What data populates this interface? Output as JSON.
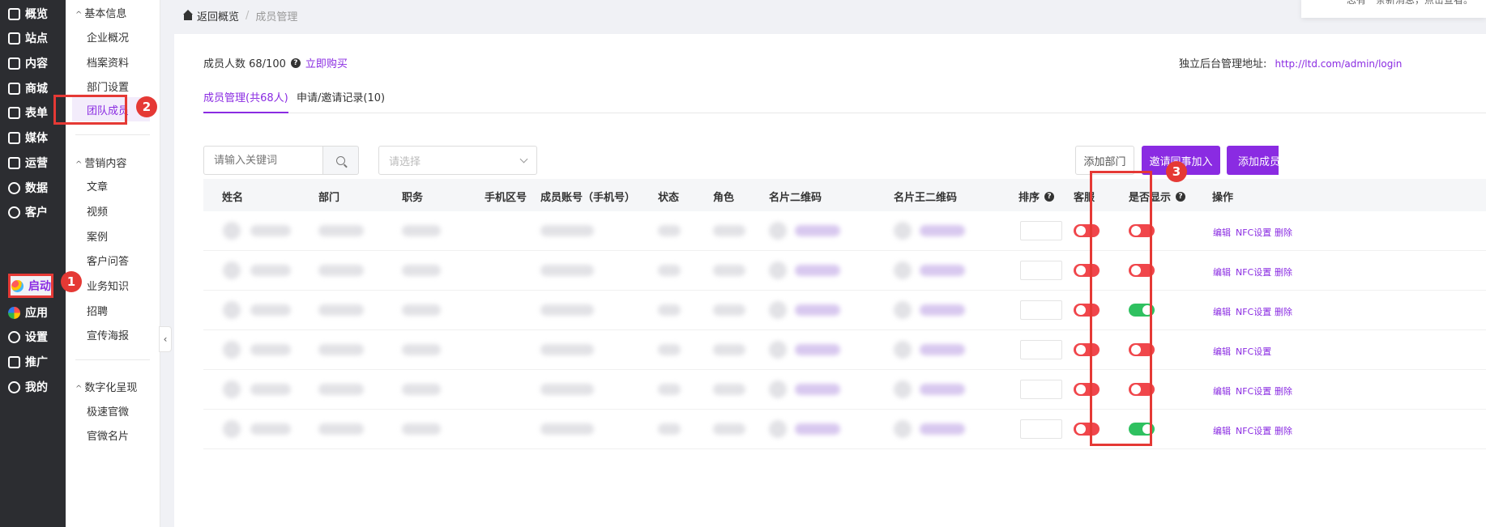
{
  "nav": {
    "items": [
      {
        "label": "概览",
        "icon": "dashboard-icon"
      },
      {
        "label": "站点",
        "icon": "home-icon"
      },
      {
        "label": "内容",
        "icon": "document-icon"
      },
      {
        "label": "商城",
        "icon": "cart-icon"
      },
      {
        "label": "表单",
        "icon": "form-icon"
      },
      {
        "label": "媒体",
        "icon": "video-icon"
      },
      {
        "label": "运营",
        "icon": "tag-icon"
      },
      {
        "label": "数据",
        "icon": "clock-icon"
      },
      {
        "label": "客户",
        "icon": "user-icon"
      },
      {
        "label": "启动",
        "icon": "launch-icon"
      },
      {
        "label": "应用",
        "icon": "apps-icon"
      },
      {
        "label": "设置",
        "icon": "gear-icon"
      },
      {
        "label": "推广",
        "icon": "bag-icon"
      },
      {
        "label": "我的",
        "icon": "person-icon"
      }
    ],
    "active_index": 9
  },
  "side": {
    "group1": "基本信息",
    "group1_items": [
      "企业概况",
      "档案资料",
      "部门设置",
      "团队成员"
    ],
    "group2": "营销内容",
    "group2_items": [
      "文章",
      "视频",
      "案例",
      "客户问答",
      "业务知识",
      "招聘",
      "宣传海报"
    ],
    "group3": "数字化呈现",
    "group3_items": [
      "极速官微",
      "官微名片"
    ],
    "active_item": "团队成员"
  },
  "breadcrumb": {
    "back": "返回概览",
    "current": "成员管理"
  },
  "notice": "志有一条新消息，点击查看。",
  "summary": {
    "member_count_label": "成员人数 68/100",
    "buy_link": "立即购买"
  },
  "admin": {
    "label": "独立后台管理地址:",
    "url": "http://ltd.com/admin/login"
  },
  "tabs": [
    {
      "label": "成员管理(共68人)",
      "active": true
    },
    {
      "label": "申请/邀请记录(10)",
      "active": false
    }
  ],
  "filters": {
    "search_placeholder": "请输入关键词",
    "select_placeholder": "请选择"
  },
  "buttons": {
    "add_department": "添加部门",
    "invite": "邀请同事加入",
    "add_member": "添加成员"
  },
  "table": {
    "headers": [
      "姓名",
      "部门",
      "职务",
      "手机区号",
      "成员账号（手机号）",
      "状态",
      "角色",
      "名片二维码",
      "名片王二维码",
      "排序",
      "客服",
      "是否显示",
      "操作"
    ],
    "rows": [
      {
        "service": false,
        "visible": false,
        "actions": [
          "编辑",
          "NFC设置",
          "删除"
        ]
      },
      {
        "service": false,
        "visible": false,
        "actions": [
          "编辑",
          "NFC设置",
          "删除"
        ]
      },
      {
        "service": false,
        "visible": true,
        "actions": [
          "编辑",
          "NFC设置",
          "删除"
        ]
      },
      {
        "service": false,
        "visible": false,
        "actions": [
          "编辑",
          "NFC设置"
        ]
      },
      {
        "service": false,
        "visible": false,
        "actions": [
          "编辑",
          "NFC设置",
          "删除"
        ]
      },
      {
        "service": false,
        "visible": true,
        "actions": [
          "编辑",
          "NFC设置",
          "删除"
        ]
      }
    ]
  },
  "annotations": [
    "1",
    "2",
    "3"
  ],
  "colors": {
    "accent": "#8a2be2",
    "highlight": "#e53935",
    "toggle_off": "#f0464b",
    "toggle_on": "#2fc160",
    "nav_bg": "#2c2d31"
  }
}
